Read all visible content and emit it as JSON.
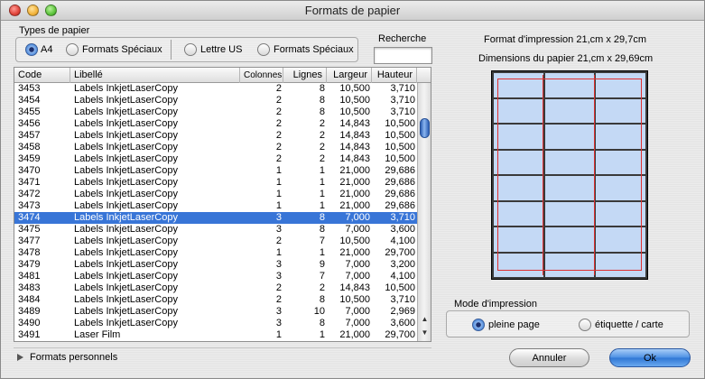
{
  "window": {
    "title": "Formats de papier"
  },
  "paper_types": {
    "label": "Types de papier",
    "options": [
      {
        "label": "A4",
        "selected": true
      },
      {
        "label": "Formats Spéciaux",
        "selected": false
      },
      {
        "label": "Lettre US",
        "selected": false
      },
      {
        "label": "Formats Spéciaux",
        "selected": false
      }
    ]
  },
  "search": {
    "label": "Recherche",
    "value": ""
  },
  "table": {
    "columns": [
      "Code",
      "Libellé",
      "Colonnes",
      "Lignes",
      "Largeur",
      "Hauteur"
    ],
    "rows": [
      [
        "3453",
        "Labels InkjetLaserCopy",
        "2",
        "8",
        "10,500",
        "3,710"
      ],
      [
        "3454",
        "Labels InkjetLaserCopy",
        "2",
        "8",
        "10,500",
        "3,710"
      ],
      [
        "3455",
        "Labels InkjetLaserCopy",
        "2",
        "8",
        "10,500",
        "3,710"
      ],
      [
        "3456",
        "Labels InkjetLaserCopy",
        "2",
        "2",
        "14,843",
        "10,500"
      ],
      [
        "3457",
        "Labels InkjetLaserCopy",
        "2",
        "2",
        "14,843",
        "10,500"
      ],
      [
        "3458",
        "Labels InkjetLaserCopy",
        "2",
        "2",
        "14,843",
        "10,500"
      ],
      [
        "3459",
        "Labels InkjetLaserCopy",
        "2",
        "2",
        "14,843",
        "10,500"
      ],
      [
        "3470",
        "Labels InkjetLaserCopy",
        "1",
        "1",
        "21,000",
        "29,686"
      ],
      [
        "3471",
        "Labels InkjetLaserCopy",
        "1",
        "1",
        "21,000",
        "29,686"
      ],
      [
        "3472",
        "Labels InkjetLaserCopy",
        "1",
        "1",
        "21,000",
        "29,686"
      ],
      [
        "3473",
        "Labels InkjetLaserCopy",
        "1",
        "1",
        "21,000",
        "29,686"
      ],
      [
        "3474",
        "Labels InkjetLaserCopy",
        "3",
        "8",
        "7,000",
        "3,710"
      ],
      [
        "3475",
        "Labels InkjetLaserCopy",
        "3",
        "8",
        "7,000",
        "3,600"
      ],
      [
        "3477",
        "Labels InkjetLaserCopy",
        "2",
        "7",
        "10,500",
        "4,100"
      ],
      [
        "3478",
        "Labels InkjetLaserCopy",
        "1",
        "1",
        "21,000",
        "29,700"
      ],
      [
        "3479",
        "Labels InkjetLaserCopy",
        "3",
        "9",
        "7,000",
        "3,200"
      ],
      [
        "3481",
        "Labels InkjetLaserCopy",
        "3",
        "7",
        "7,000",
        "4,100"
      ],
      [
        "3483",
        "Labels InkjetLaserCopy",
        "2",
        "2",
        "14,843",
        "10,500"
      ],
      [
        "3484",
        "Labels InkjetLaserCopy",
        "2",
        "8",
        "10,500",
        "3,710"
      ],
      [
        "3489",
        "Labels InkjetLaserCopy",
        "3",
        "10",
        "7,000",
        "2,969"
      ],
      [
        "3490",
        "Labels InkjetLaserCopy",
        "3",
        "8",
        "7,000",
        "3,600"
      ],
      [
        "3491",
        "Laser Film",
        "1",
        "1",
        "21,000",
        "29,700"
      ]
    ],
    "selected_code": "3474"
  },
  "info": {
    "print_format": "Format d'impression 21,cm x 29,7cm",
    "paper_dimensions": "Dimensions du papier 21,cm x 29,69cm"
  },
  "print_mode": {
    "label": "Mode d'impression",
    "options": [
      {
        "label": "pleine page",
        "selected": true
      },
      {
        "label": "étiquette / carte",
        "selected": false
      }
    ]
  },
  "custom_formats": {
    "label": "Formats personnels"
  },
  "buttons": {
    "cancel": "Annuler",
    "ok": "Ok"
  },
  "preview": {
    "columns": 3,
    "rows": 8
  }
}
